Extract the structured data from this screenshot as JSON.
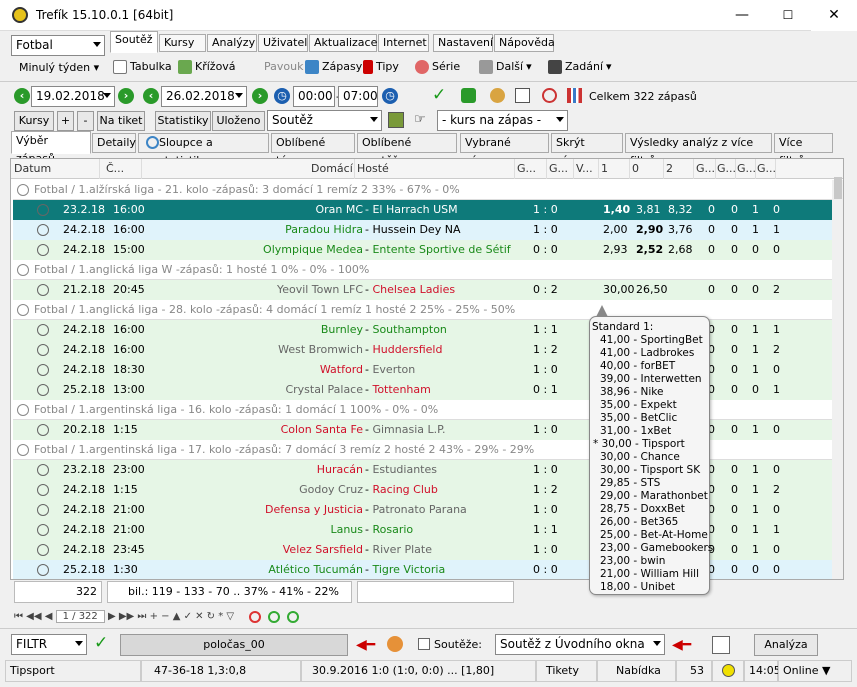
{
  "window": {
    "title": "Trefík 15.10.0.1 [64bit]",
    "min": "—",
    "max": "☐",
    "close": "✕"
  },
  "sport": "Fotbal",
  "period": "Minulý týden",
  "menu": [
    "Soutěž",
    "Kursy",
    "Analýzy",
    "Uživatel",
    "Aktualizace",
    "Internet",
    "Nastavení",
    "Nápověda"
  ],
  "toolbar": {
    "tabulka": "Tabulka",
    "krizova": "Křížová",
    "pavouk": "Pavouk",
    "zapasy": "Zápasy",
    "tipy": "Tipy",
    "serie": "Série",
    "dalsi": "Další",
    "zadani": "Zadání"
  },
  "filter": {
    "date_from": "19.02.2018",
    "date_to": "26.02.2018",
    "time_from": "00:00",
    "time_to": "07:00",
    "summary": "Celkem 322 zápasů"
  },
  "buttons": {
    "kursy": "Kursy",
    "plus": "+",
    "minus": "-",
    "natiket": "Na tiket",
    "statistiky": "Statistiky",
    "ulozeno": "Uloženo",
    "soutez": "Soutěž",
    "kurs": "- kurs na zápas -"
  },
  "tabs": [
    "Výběr zápasů",
    "Detaily",
    "Sloupce a statistiky",
    "Oblíbené týmy",
    "Oblíbené soutěže",
    "Vybrané zápasy",
    "Skrýt zápasy",
    "Výsledky analýz z více filtrů",
    "Více filtrů"
  ],
  "columns": {
    "datum": "Datum",
    "cas": "Č...",
    "domaci": "Domácí",
    "hoste": "Hosté",
    "g1": "G...",
    "g2": "G...",
    "v": "V...",
    "o1": "1",
    "o0": "0",
    "o2": "2",
    "g3": "G...",
    "g4": "G...",
    "g5": "G...",
    "g6": "G..."
  },
  "rows": [
    {
      "type": "group",
      "text": "Fotbal / 1.alžírská liga - 21. kolo -zápasů: 3  domácí 1  remíz 2       33% - 67% - 0%"
    },
    {
      "type": "match",
      "date": "23.2.18",
      "time": "16:00",
      "home": "Oran MC",
      "home_c": "",
      "away": "El Harrach USM",
      "away_c": "",
      "score": "1 : 0",
      "o1": "1,40",
      "o0": "3,81",
      "o2": "8,32",
      "g": [
        "0",
        "0",
        "1",
        "0"
      ],
      "style": "sel",
      "bold": "o1"
    },
    {
      "type": "match",
      "date": "24.2.18",
      "time": "16:00",
      "home": "Paradou Hidra",
      "home_c": "green",
      "away": "Hussein Dey NA",
      "away_c": "",
      "score": "1 : 0",
      "o1": "2,00",
      "o0": "2,90",
      "o2": "3,76",
      "g": [
        "0",
        "0",
        "1",
        "1"
      ],
      "style": "alt",
      "bold": "o0"
    },
    {
      "type": "match",
      "date": "24.2.18",
      "time": "15:00",
      "home": "Olympique Medea",
      "home_c": "green",
      "away": "Entente Sportive de Sétif",
      "away_c": "green",
      "score": "0 : 0",
      "o1": "2,93",
      "o0": "2,52",
      "o2": "2,68",
      "g": [
        "0",
        "0",
        "0",
        "0"
      ],
      "style": "",
      "bold": "o0"
    },
    {
      "type": "group",
      "text": "Fotbal / 1.anglická liga W -zápasů: 1      hosté 1     0% - 0% - 100%"
    },
    {
      "type": "match",
      "date": "21.2.18",
      "time": "20:45",
      "home": "Yeovil Town LFC",
      "home_c": "gray",
      "away": "Chelsea Ladies",
      "away_c": "red",
      "score": "0 : 2",
      "o1": "30,00",
      "o0": "26,50",
      "o2": "",
      "g": [
        "0",
        "0",
        "0",
        "2"
      ],
      "style": "",
      "bold": ""
    },
    {
      "type": "group",
      "text": "Fotbal / 1.anglická liga - 28. kolo -zápasů: 4  domácí 1  remíz 1  hosté 2     25% - 25% - 50%"
    },
    {
      "type": "match",
      "date": "24.2.18",
      "time": "16:00",
      "home": "Burnley",
      "home_c": "green",
      "away": "Southampton",
      "away_c": "green",
      "score": "1 : 1",
      "o1": "",
      "o0": "",
      "o2": "",
      "g": [
        "0",
        "0",
        "1",
        "1"
      ],
      "style": "",
      "bold": ""
    },
    {
      "type": "match",
      "date": "24.2.18",
      "time": "16:00",
      "home": "West Bromwich",
      "home_c": "gray",
      "away": "Huddersfield",
      "away_c": "red",
      "score": "1 : 2",
      "o1": "",
      "o0": "",
      "o2": "",
      "g": [
        "0",
        "0",
        "1",
        "2"
      ],
      "style": "",
      "bold": ""
    },
    {
      "type": "match",
      "date": "24.2.18",
      "time": "18:30",
      "home": "Watford",
      "home_c": "red",
      "away": "Everton",
      "away_c": "gray",
      "score": "1 : 0",
      "o1": "",
      "o0": "",
      "o2": "",
      "g": [
        "0",
        "0",
        "1",
        "0"
      ],
      "style": "",
      "bold": ""
    },
    {
      "type": "match",
      "date": "25.2.18",
      "time": "13:00",
      "home": "Crystal Palace",
      "home_c": "gray",
      "away": "Tottenham",
      "away_c": "red",
      "score": "0 : 1",
      "o1": "",
      "o0": "",
      "o2": "",
      "g": [
        "0",
        "0",
        "0",
        "1"
      ],
      "style": "",
      "bold": ""
    },
    {
      "type": "group",
      "text": "Fotbal / 1.argentinská liga - 16. kolo -zápasů: 1  domácí 1          100% - 0% - 0%"
    },
    {
      "type": "match",
      "date": "20.2.18",
      "time": "1:15",
      "home": "Colon Santa Fe",
      "home_c": "red",
      "away": "Gimnasia L.P.",
      "away_c": "gray",
      "score": "1 : 0",
      "o1": "",
      "o0": "",
      "o2": "",
      "g": [
        "0",
        "0",
        "1",
        "0"
      ],
      "style": "",
      "bold": ""
    },
    {
      "type": "group",
      "text": "Fotbal / 1.argentinská liga - 17. kolo -zápasů: 7  domácí 3  remíz 2  hosté 2     43% - 29% - 29%"
    },
    {
      "type": "match",
      "date": "23.2.18",
      "time": "23:00",
      "home": "Huracán",
      "home_c": "red",
      "away": "Estudiantes",
      "away_c": "gray",
      "score": "1 : 0",
      "o1": "",
      "o0": "",
      "o2": "",
      "g": [
        "0",
        "0",
        "1",
        "0"
      ],
      "style": "",
      "bold": ""
    },
    {
      "type": "match",
      "date": "24.2.18",
      "time": "1:15",
      "home": "Godoy Cruz",
      "home_c": "gray",
      "away": "Racing Club",
      "away_c": "red",
      "score": "1 : 2",
      "o1": "",
      "o0": "",
      "o2": "",
      "g": [
        "0",
        "0",
        "1",
        "2"
      ],
      "style": "",
      "bold": ""
    },
    {
      "type": "match",
      "date": "24.2.18",
      "time": "21:00",
      "home": "Defensa y Justicia",
      "home_c": "red",
      "away": "Patronato Parana",
      "away_c": "gray",
      "score": "1 : 0",
      "o1": "",
      "o0": "",
      "o2": "",
      "g": [
        "0",
        "0",
        "1",
        "0"
      ],
      "style": "",
      "bold": ""
    },
    {
      "type": "match",
      "date": "24.2.18",
      "time": "21:00",
      "home": "Lanus",
      "home_c": "green",
      "away": "Rosario",
      "away_c": "green",
      "score": "1 : 1",
      "o1": "",
      "o0": "",
      "o2": "",
      "g": [
        "0",
        "0",
        "1",
        "1"
      ],
      "style": "",
      "bold": ""
    },
    {
      "type": "match",
      "date": "24.2.18",
      "time": "23:45",
      "home": "Velez Sarsfield",
      "home_c": "red",
      "away": "River Plate",
      "away_c": "gray",
      "score": "1 : 0",
      "o1": "",
      "o0": "",
      "o2": "",
      "g": [
        "0",
        "0",
        "1",
        "0"
      ],
      "style": "",
      "bold": ""
    },
    {
      "type": "match",
      "date": "25.2.18",
      "time": "1:30",
      "home": "Atlético Tucumán",
      "home_c": "green",
      "away": "Tigre Victoria",
      "away_c": "green",
      "score": "0 : 0",
      "o1": "",
      "o0": "",
      "o2": "",
      "g": [
        "0",
        "0",
        "0",
        "0"
      ],
      "style": "alt",
      "bold": ""
    }
  ],
  "popup": {
    "header": "Standard      1:",
    "lines": [
      "41,00 - SportingBet",
      "41,00 - Ladbrokes",
      "40,00 - forBET",
      "39,00 - Interwetten",
      "38,96 - Nike",
      "35,00 - Expekt",
      "35,00 - BetClic",
      "31,00 - 1xBet",
      "* 30,00 - Tipsport",
      "30,00 - Chance",
      "30,00 - Tipsport SK",
      "29,85 - STS",
      "29,00 - Marathonbet",
      "28,75 - DoxxBet",
      "26,00 - Bet365",
      "25,00 - Bet-At-Home",
      "23,00 - Gamebookers",
      "23,00 - bwin",
      "21,00 - William Hill",
      "18,00 - Unibet"
    ]
  },
  "footer": {
    "count": "322",
    "stats": "bil.: 119 - 133 - 70 .. 37% - 41% - 22%",
    "page": "1 / 322"
  },
  "bottom": {
    "filtr": "FILTR",
    "polocas": "poločas_00",
    "souteze": "Soutěže:",
    "soutez_okno": "Soutěž z Úvodního okna",
    "analyza": "Analýza"
  },
  "status": {
    "tipsport": "Tipsport",
    "record": "47-36-18  1,3:0,8",
    "last": "30.9.2016 1:0 (1:0, 0:0) ... [1,80]",
    "tikety": "Tikety",
    "nabidka": "Nabídka",
    "count": "53",
    "time": "14:05",
    "online": "Online ▼"
  }
}
